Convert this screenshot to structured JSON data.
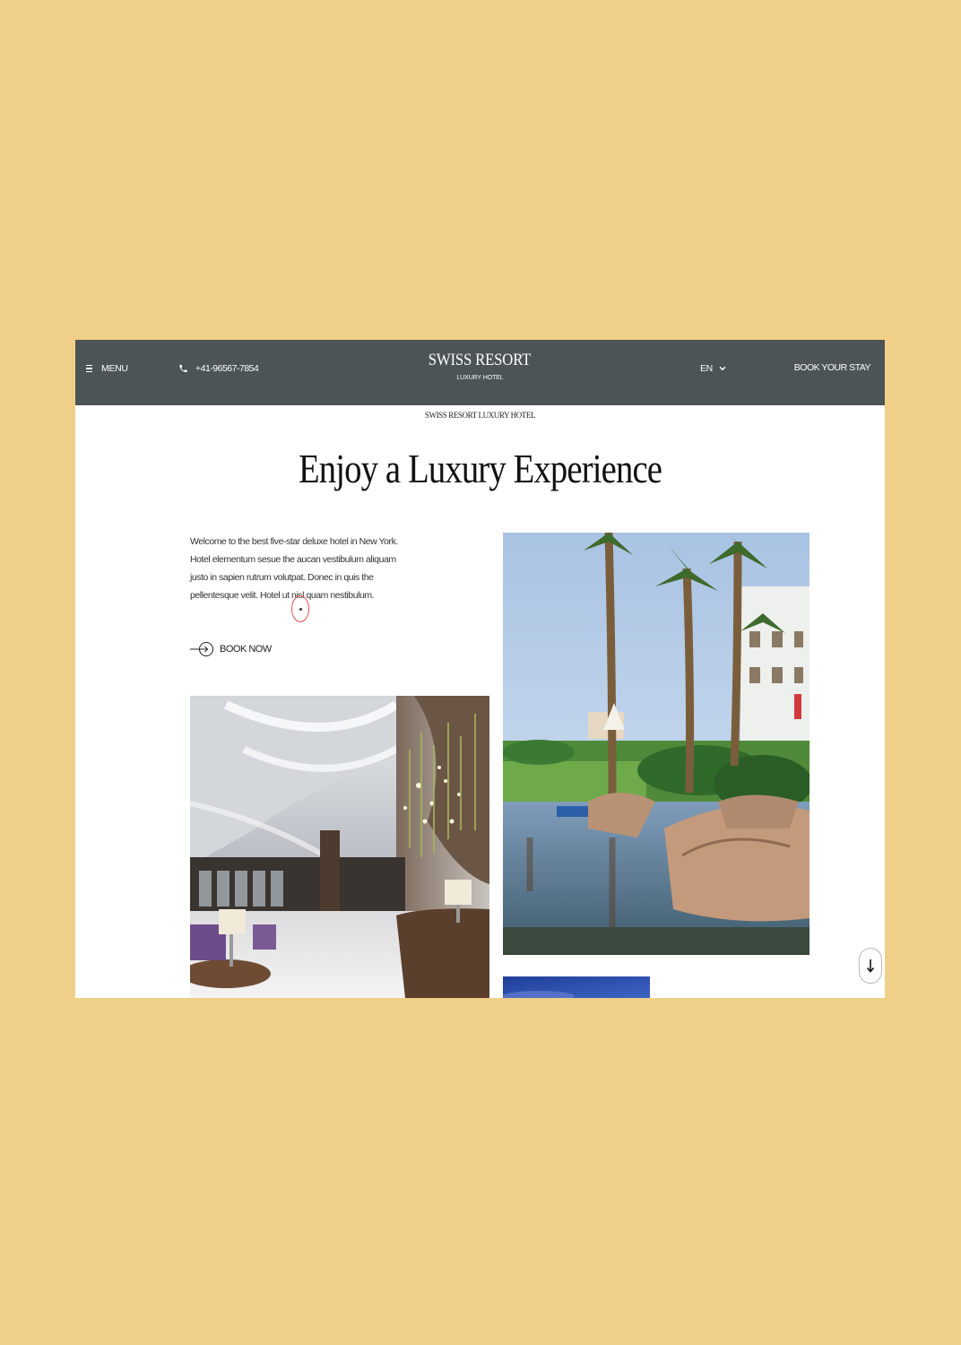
{
  "header": {
    "menu_label": "MENU",
    "phone": "+41-96567-7854",
    "brand_name": "SWISS RESORT",
    "brand_sub": "LUXURY HOTEL",
    "language": "EN",
    "book_stay_label": "BOOK YOUR STAY"
  },
  "main": {
    "kicker": "SWISS RESORT LUXURY HOTEL",
    "headline": "Enjoy a Luxury Experience",
    "intro": "Welcome to the best five-star deluxe hotel in New York. Hotel elementum sesue the aucan vestibulum aliquam justo in sapien rutrum volutpat. Donec in quis the pellentesque velit. Hotel ut nisl quam nestibulum.",
    "book_now_label": "BOOK NOW"
  },
  "icons": {
    "menu": "hamburger-icon",
    "phone": "phone-icon",
    "language": "chevron-down-icon",
    "book_now": "arrow-circle-icon",
    "scroll": "arrow-down-icon"
  },
  "colors": {
    "page_background": "#f0d089",
    "topbar": "#4d5456",
    "content_background": "#ffffff",
    "cursor_ring": "#e25151"
  }
}
